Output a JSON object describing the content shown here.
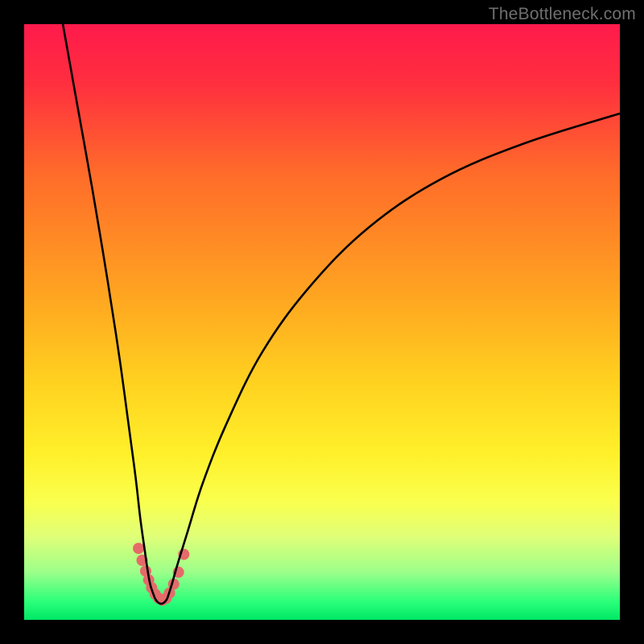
{
  "watermark": "TheBottleneck.com",
  "chart_data": {
    "type": "line",
    "title": "",
    "xlabel": "",
    "ylabel": "",
    "xlim": [
      0,
      100
    ],
    "ylim": [
      0,
      100
    ],
    "grid": false,
    "gradient_stops": [
      {
        "offset": 0.0,
        "color": "#ff1a4b"
      },
      {
        "offset": 0.1,
        "color": "#ff2f3f"
      },
      {
        "offset": 0.25,
        "color": "#ff6b2a"
      },
      {
        "offset": 0.45,
        "color": "#ffa321"
      },
      {
        "offset": 0.6,
        "color": "#ffd11f"
      },
      {
        "offset": 0.72,
        "color": "#fff02a"
      },
      {
        "offset": 0.8,
        "color": "#faff4d"
      },
      {
        "offset": 0.86,
        "color": "#e0ff78"
      },
      {
        "offset": 0.92,
        "color": "#9cff8a"
      },
      {
        "offset": 0.97,
        "color": "#2aff7a"
      },
      {
        "offset": 1.0,
        "color": "#00e765"
      }
    ],
    "series": [
      {
        "name": "left_branch",
        "x": [
          6.5,
          9,
          11.5,
          14,
          16,
          17.5,
          18.7,
          19.5,
          20.2,
          20.7,
          21.2,
          22.0
        ],
        "y": [
          100,
          86,
          72,
          57,
          44,
          33,
          24,
          17,
          12,
          8.5,
          5.8,
          3.5
        ]
      },
      {
        "name": "right_branch",
        "x": [
          24.0,
          24.8,
          25.8,
          27.5,
          30,
          34,
          40,
          48,
          58,
          70,
          84,
          100
        ],
        "y": [
          3.5,
          6.0,
          9.5,
          15,
          23,
          33,
          45,
          56,
          66,
          74,
          80,
          85
        ]
      },
      {
        "name": "valley",
        "x": [
          22.0,
          22.5,
          23.0,
          23.5,
          24.0
        ],
        "y": [
          3.5,
          2.9,
          2.7,
          2.9,
          3.5
        ]
      }
    ],
    "markers": {
      "name": "valley_points",
      "x": [
        19.2,
        19.8,
        20.4,
        20.9,
        21.4,
        22.0,
        22.6,
        23.2,
        23.8,
        24.4,
        25.1,
        25.9,
        26.8
      ],
      "y": [
        12.0,
        10.0,
        8.2,
        6.7,
        5.4,
        4.3,
        3.6,
        3.3,
        3.6,
        4.5,
        6.0,
        8.0,
        11.0
      ],
      "color": "#e56a6a",
      "radius_px": 7
    }
  }
}
